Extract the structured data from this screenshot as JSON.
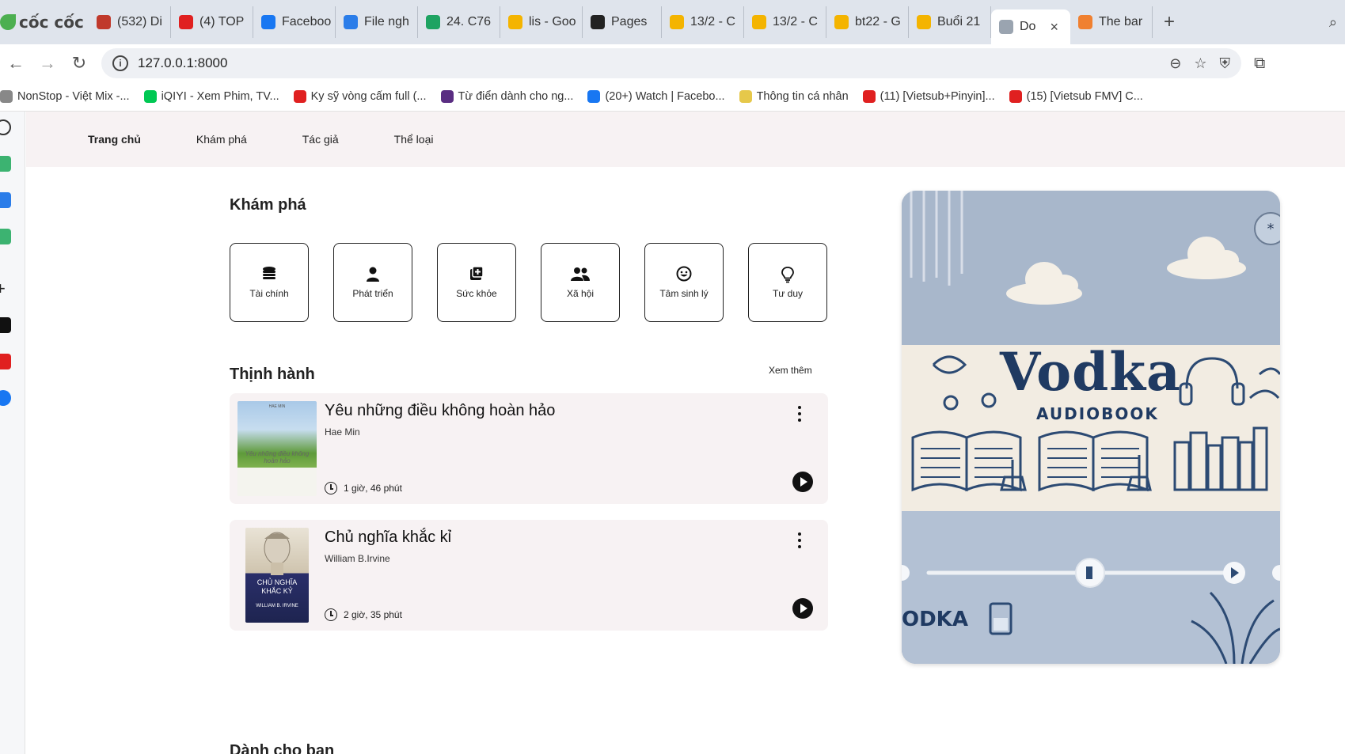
{
  "browser": {
    "brand": "cốc cốc",
    "tabs": [
      {
        "label": "(532) Di",
        "color": "#c0392b"
      },
      {
        "label": "(4) TOP",
        "color": "#e02020"
      },
      {
        "label": "Faceboo",
        "color": "#1877f2"
      },
      {
        "label": "File ngh",
        "color": "#2b7de9"
      },
      {
        "label": "24. C76",
        "color": "#1ea362"
      },
      {
        "label": "lis - Goo",
        "color": "#f4b400"
      },
      {
        "label": "Pages",
        "color": "#222222"
      },
      {
        "label": "13/2 - C",
        "color": "#f4b400"
      },
      {
        "label": "13/2 - C",
        "color": "#f4b400"
      },
      {
        "label": "bt22 - G",
        "color": "#f4b400"
      },
      {
        "label": "Buổi 21",
        "color": "#f4b400"
      },
      {
        "label": "Do",
        "color": "#9aa4b0",
        "active": true
      },
      {
        "label": "The bar",
        "color": "#f08030"
      }
    ],
    "address": "127.0.0.1:8000",
    "bookmarks": [
      {
        "label": "NonStop - Việt Mix -...",
        "color": "#888888"
      },
      {
        "label": "iQIYI - Xem Phim, TV...",
        "color": "#00c853"
      },
      {
        "label": "Ky sỹ vòng cấm full (...",
        "color": "#e02020"
      },
      {
        "label": "Từ điển dành cho ng...",
        "color": "#5a2d82"
      },
      {
        "label": "(20+) Watch | Facebo...",
        "color": "#1877f2"
      },
      {
        "label": "Thông tin cá nhân",
        "color": "#e6c84a"
      },
      {
        "label": "(11) [Vietsub+Pinyin]...",
        "color": "#e02020"
      },
      {
        "label": "(15) [Vietsub FMV] C...",
        "color": "#e02020"
      }
    ]
  },
  "nav": {
    "items": [
      "Trang chủ",
      "Khám phá",
      "Tác giả",
      "Thể loại"
    ]
  },
  "explore": {
    "title": "Khám phá",
    "categories": [
      {
        "label": "Tài chính",
        "icon": "coins-icon"
      },
      {
        "label": "Phát triển",
        "icon": "person-icon"
      },
      {
        "label": "Sức khỏe",
        "icon": "medical-plus-icon"
      },
      {
        "label": "Xã hội",
        "icon": "users-icon"
      },
      {
        "label": "Tâm sinh lý",
        "icon": "smile-icon"
      },
      {
        "label": "Tư duy",
        "icon": "lightbulb-icon"
      }
    ]
  },
  "trending": {
    "title": "Thịnh hành",
    "more": "Xem thêm",
    "books": [
      {
        "title": "Yêu những điều không hoàn hảo",
        "author": "Hae Min",
        "duration": "1 giờ, 46 phút",
        "cover_text": "Yêu những điều không hoàn hảo",
        "cover_top": "HAE MIN"
      },
      {
        "title": "Chủ nghĩa khắc kỉ",
        "author": "William B.Irvine",
        "duration": "2 giờ, 35 phút",
        "cover_text": "CHỦ NGHĨA KHẮC KỶ",
        "cover_top": "WILLIAM B. IRVINE"
      }
    ]
  },
  "for_you": {
    "title": "Dành cho bạn"
  },
  "promo": {
    "brand": "Vodka",
    "subtitle": "AUDIOBOOK",
    "footer_brand": "ODKA"
  }
}
